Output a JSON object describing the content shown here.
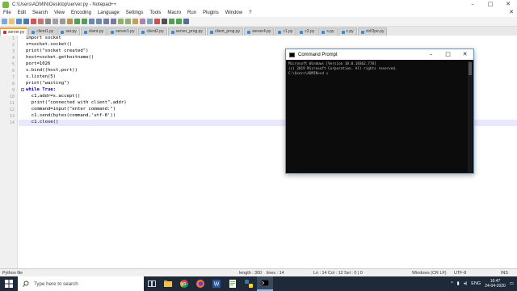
{
  "window": {
    "title": "C:\\Users\\ADMIN\\Desktop\\server.py - Notepad++"
  },
  "menu": [
    "File",
    "Edit",
    "Search",
    "View",
    "Encoding",
    "Language",
    "Settings",
    "Tools",
    "Macro",
    "Run",
    "Plugins",
    "Window",
    "?"
  ],
  "tabs": [
    {
      "label": "server.py",
      "active": true
    },
    {
      "label": "client1.py",
      "active": false
    },
    {
      "label": "ser.py",
      "active": false
    },
    {
      "label": "client.py",
      "active": false
    },
    {
      "label": "server1.py",
      "active": false
    },
    {
      "label": "client2.py",
      "active": false
    },
    {
      "label": "server_prog.py",
      "active": false
    },
    {
      "label": "client_prog.py",
      "active": false
    },
    {
      "label": "server4.py",
      "active": false
    },
    {
      "label": "c1.py",
      "active": false
    },
    {
      "label": "c2.py",
      "active": false
    },
    {
      "label": "s.py",
      "active": false
    },
    {
      "label": "c.py",
      "active": false
    },
    {
      "label": "ctrlOpe.py",
      "active": false
    }
  ],
  "editor": {
    "lines": [
      {
        "num": "1",
        "text": "import socket"
      },
      {
        "num": "2",
        "text": "s=socket.socket()"
      },
      {
        "num": "3",
        "text": "print(\"socket created\")"
      },
      {
        "num": "4",
        "text": "host=socket.gethostname()"
      },
      {
        "num": "5",
        "text": "port=1026"
      },
      {
        "num": "6",
        "text": "s.bind((host,port))"
      },
      {
        "num": "7",
        "text": "s.listen(5)"
      },
      {
        "num": "8",
        "text": "print(\"waiting\")"
      },
      {
        "num": "9",
        "text": "while True:"
      },
      {
        "num": "10",
        "text": "  c1,addr=s.accept()"
      },
      {
        "num": "11",
        "text": "  print(\"connected with client\",addr)"
      },
      {
        "num": "12",
        "text": "  command=input(\"enter command:\")"
      },
      {
        "num": "13",
        "text": "  c1.send(bytes(command,'utf-8'))"
      },
      {
        "num": "14",
        "text": "  c1.close()"
      }
    ]
  },
  "status": {
    "file_type": "Python file",
    "length": "length : 300",
    "lines": "lines : 14",
    "position": "Ln : 14   Col : 12   Sel : 0 | 0",
    "eol": "Windows (CR LF)",
    "encoding": "UTF-8",
    "mode": "INS"
  },
  "cmd": {
    "title": "Command Prompt",
    "lines": [
      "Microsoft Windows [Version 10.0.18362.778]",
      "(c) 2019 Microsoft Corporation. All rights reserved.",
      "",
      "C:\\Users\\ADMIN>cd s"
    ]
  },
  "taskbar": {
    "search_placeholder": "Type here to search",
    "lang": "ENG",
    "time": "16:47",
    "date": "24-04-2020"
  },
  "colors": {
    "taskbar": "#1e2a3a",
    "active_tab_accent": "#f6a500",
    "keyword": "#0000c0"
  }
}
